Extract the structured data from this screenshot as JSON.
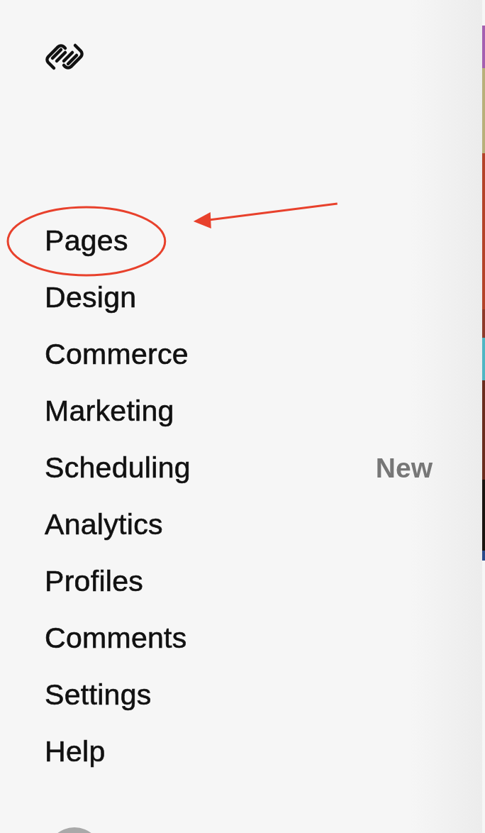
{
  "sidebar": {
    "items": [
      {
        "label": "Pages",
        "highlighted": true
      },
      {
        "label": "Design",
        "highlighted": false
      },
      {
        "label": "Commerce",
        "highlighted": false
      },
      {
        "label": "Marketing",
        "highlighted": false
      },
      {
        "label": "Scheduling",
        "badge": "New",
        "highlighted": false
      },
      {
        "label": "Analytics",
        "highlighted": false
      },
      {
        "label": "Profiles",
        "highlighted": false
      },
      {
        "label": "Comments",
        "highlighted": false
      },
      {
        "label": "Settings",
        "highlighted": false
      },
      {
        "label": "Help",
        "highlighted": false
      }
    ]
  }
}
